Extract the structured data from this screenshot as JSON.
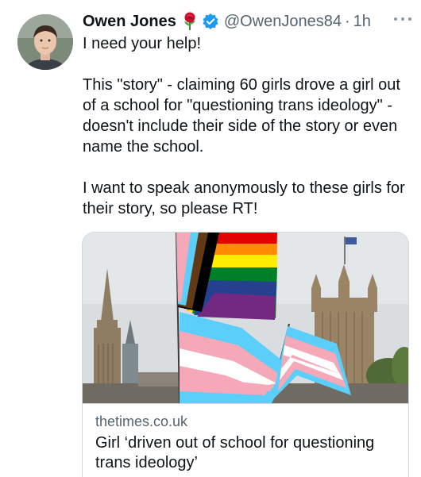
{
  "tweet": {
    "author_name": "Owen Jones",
    "author_handle": "@OwenJones84",
    "separator": "·",
    "time": "1h",
    "icons": {
      "rose": "rose-emoji-icon",
      "verified": "verified-badge-icon",
      "more": "more-options-icon"
    },
    "paragraphs": [
      "I need your help!",
      "This \"story\" - claiming 60 girls drove a girl out of a school for \"questioning trans ideology\" - doesn't include their side of the story or even name the school.",
      "I want to speak anonymously to these girls for their story, so please RT!"
    ]
  },
  "link_card": {
    "domain": "thetimes.co.uk",
    "title": "Girl ‘driven out of school for questioning trans ideology’"
  },
  "colors": {
    "text_primary": "#0f1419",
    "text_secondary": "#536471",
    "verified_blue": "#1d9bf0",
    "card_border": "#cfd9de"
  }
}
